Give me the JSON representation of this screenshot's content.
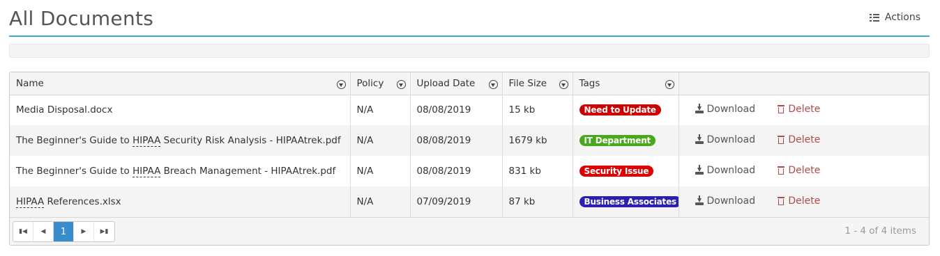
{
  "header": {
    "title": "All Documents",
    "actions_label": "Actions"
  },
  "table": {
    "columns": [
      "Name",
      "Policy",
      "Upload Date",
      "File Size",
      "Tags"
    ],
    "rows": [
      {
        "name_parts": [
          "Media Disposal.docx"
        ],
        "policy": "N/A",
        "upload_date": "08/08/2019",
        "file_size": "15 kb",
        "tag": "Need to Update",
        "tag_color": "#cc0000"
      },
      {
        "name_parts": [
          "The Beginner's Guide to ",
          "HIPAA",
          " Security Risk Analysis - HIPAAtrek.pdf"
        ],
        "policy": "N/A",
        "upload_date": "08/08/2019",
        "file_size": "1679 kb",
        "tag": "IT Department",
        "tag_color": "#4aa81c"
      },
      {
        "name_parts": [
          "The Beginner's Guide to ",
          "HIPAA",
          " Breach Management - HIPAAtrek.pdf"
        ],
        "policy": "N/A",
        "upload_date": "08/08/2019",
        "file_size": "831 kb",
        "tag": "Security Issue",
        "tag_color": "#dd0000"
      },
      {
        "name_parts": [
          "HIPAA",
          " References.xlsx"
        ],
        "policy": "N/A",
        "upload_date": "07/09/2019",
        "file_size": "87 kb",
        "tag": "Business Associates",
        "tag_color": "#2a1fb0"
      }
    ],
    "download_label": "Download",
    "delete_label": "Delete"
  },
  "pager": {
    "current_page": "1",
    "info": "1 - 4 of 4 items"
  }
}
